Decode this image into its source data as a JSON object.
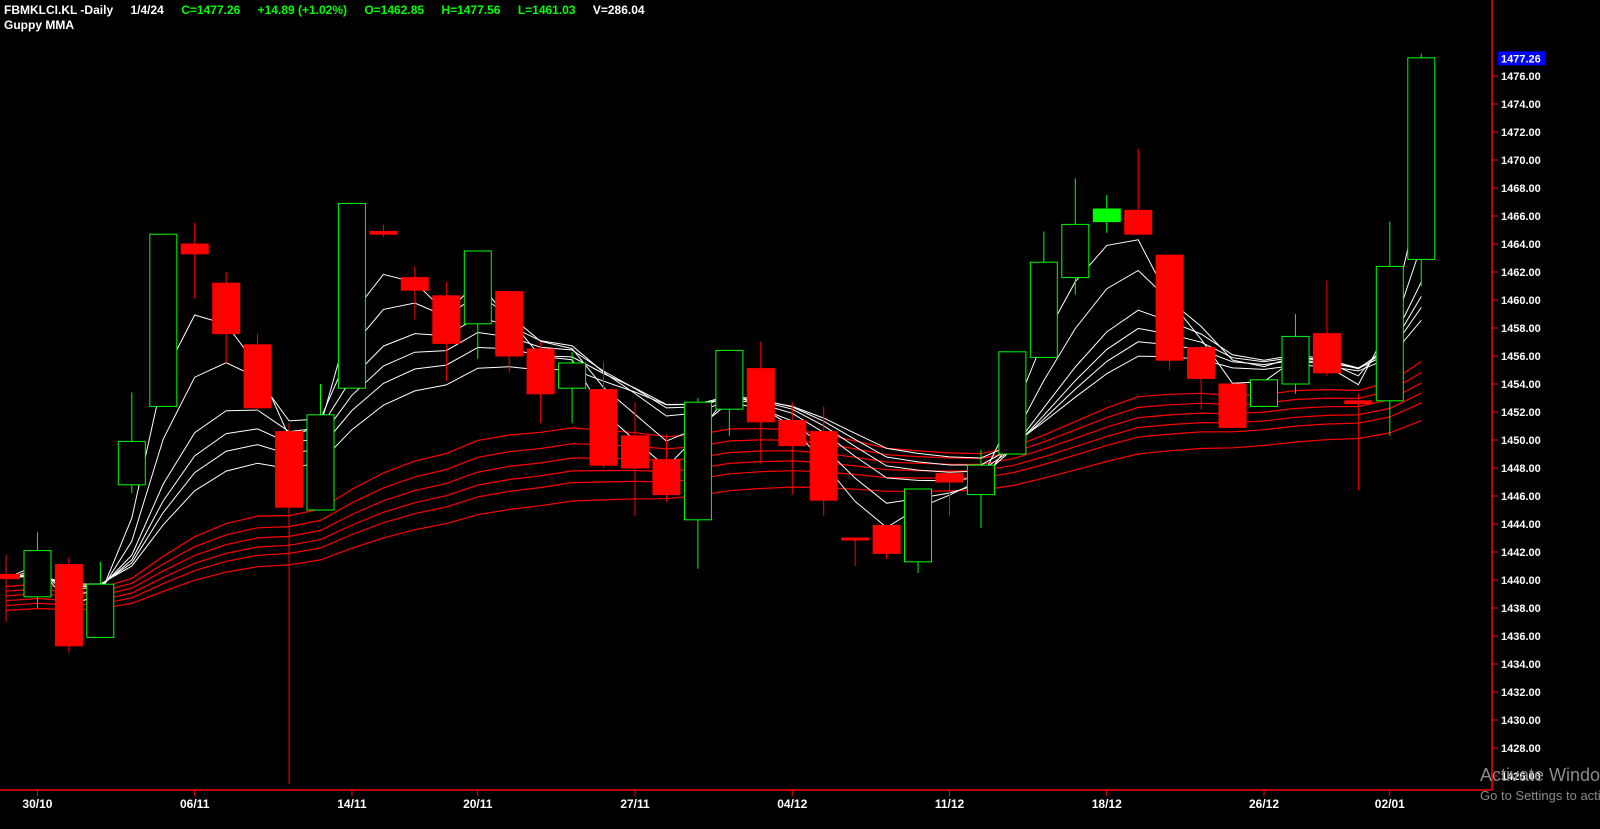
{
  "header": {
    "symbol": "FBMKLCI.KL -Daily",
    "date": "1/4/24",
    "close": "C=1477.26",
    "change": "+14.89 (+1.02%)",
    "open": "O=1462.85",
    "high": "H=1477.56",
    "low": "L=1461.03",
    "volume": "V=286.04",
    "indicator": "Guppy MMA"
  },
  "watermark": {
    "line1": "Activate Windows",
    "line2": "Go to Settings to activate Windows."
  },
  "colors": {
    "background": "#000000",
    "up": "#00ff00",
    "down": "#ff0000",
    "short_mma": "#ffffff",
    "long_mma": "#ff0000",
    "axis": "#ff0000",
    "last_price_badge": "#0000ff"
  },
  "chart_data": {
    "type": "candlestick",
    "ylim": [
      1425,
      1479
    ],
    "y_ticks": [
      1426,
      1428,
      1430,
      1432,
      1434,
      1436,
      1438,
      1440,
      1442,
      1444,
      1446,
      1448,
      1450,
      1452,
      1454,
      1456,
      1458,
      1460,
      1462,
      1464,
      1466,
      1468,
      1470,
      1472,
      1474,
      1476
    ],
    "last_price": "1477.26",
    "x_labels": [
      {
        "index": 1,
        "label": "30/10"
      },
      {
        "index": 6,
        "label": "06/11"
      },
      {
        "index": 11,
        "label": "14/11"
      },
      {
        "index": 15,
        "label": "20/11"
      },
      {
        "index": 20,
        "label": "27/11"
      },
      {
        "index": 25,
        "label": "04/12"
      },
      {
        "index": 30,
        "label": "11/12"
      },
      {
        "index": 35,
        "label": "18/12"
      },
      {
        "index": 40,
        "label": "26/12"
      },
      {
        "index": 44,
        "label": "02/01"
      }
    ],
    "candles": [
      {
        "o": 1440.4,
        "h": 1441.8,
        "l": 1437.0,
        "c": 1440.1
      },
      {
        "o": 1438.8,
        "h": 1443.4,
        "l": 1438.0,
        "c": 1442.1
      },
      {
        "o": 1441.1,
        "h": 1441.6,
        "l": 1434.8,
        "c": 1435.3
      },
      {
        "o": 1435.9,
        "h": 1441.3,
        "l": 1435.9,
        "c": 1439.7
      },
      {
        "o": 1446.8,
        "h": 1453.4,
        "l": 1446.2,
        "c": 1449.9
      },
      {
        "o": 1452.4,
        "h": 1464.7,
        "l": 1452.4,
        "c": 1464.7
      },
      {
        "o": 1464.0,
        "h": 1465.5,
        "l": 1460.1,
        "c": 1463.3
      },
      {
        "o": 1461.2,
        "h": 1462.0,
        "l": 1455.5,
        "c": 1457.6
      },
      {
        "o": 1456.8,
        "h": 1457.6,
        "l": 1452.1,
        "c": 1452.3
      },
      {
        "o": 1450.6,
        "h": 1451.2,
        "l": 1425.4,
        "c": 1445.2
      },
      {
        "o": 1445.0,
        "h": 1454.0,
        "l": 1445.0,
        "c": 1451.8
      },
      {
        "o": 1453.7,
        "h": 1466.9,
        "l": 1453.7,
        "c": 1466.9
      },
      {
        "o": 1464.9,
        "h": 1465.4,
        "l": 1464.5,
        "c": 1464.7
      },
      {
        "o": 1461.6,
        "h": 1462.4,
        "l": 1458.6,
        "c": 1460.7
      },
      {
        "o": 1460.3,
        "h": 1461.3,
        "l": 1454.2,
        "c": 1456.9
      },
      {
        "o": 1458.3,
        "h": 1463.5,
        "l": 1455.8,
        "c": 1463.5
      },
      {
        "o": 1460.6,
        "h": 1460.6,
        "l": 1454.8,
        "c": 1456.0
      },
      {
        "o": 1456.5,
        "h": 1457.0,
        "l": 1451.2,
        "c": 1453.3
      },
      {
        "o": 1453.7,
        "h": 1456.3,
        "l": 1451.2,
        "c": 1455.5
      },
      {
        "o": 1453.6,
        "h": 1455.6,
        "l": 1448.0,
        "c": 1448.2
      },
      {
        "o": 1450.3,
        "h": 1452.7,
        "l": 1444.6,
        "c": 1448.0
      },
      {
        "o": 1448.6,
        "h": 1450.4,
        "l": 1445.6,
        "c": 1446.1
      },
      {
        "o": 1444.3,
        "h": 1453.0,
        "l": 1440.8,
        "c": 1452.7
      },
      {
        "o": 1452.2,
        "h": 1456.4,
        "l": 1450.3,
        "c": 1456.4
      },
      {
        "o": 1455.1,
        "h": 1457.0,
        "l": 1448.3,
        "c": 1451.3
      },
      {
        "o": 1451.4,
        "h": 1452.7,
        "l": 1446.1,
        "c": 1449.6
      },
      {
        "o": 1450.6,
        "h": 1452.4,
        "l": 1444.6,
        "c": 1445.7
      },
      {
        "o": 1443.0,
        "h": 1443.0,
        "l": 1441.0,
        "c": 1442.9
      },
      {
        "o": 1443.9,
        "h": 1443.9,
        "l": 1441.5,
        "c": 1441.9
      },
      {
        "o": 1441.3,
        "h": 1446.5,
        "l": 1440.5,
        "c": 1446.5
      },
      {
        "o": 1447.6,
        "h": 1447.6,
        "l": 1444.6,
        "c": 1447.0
      },
      {
        "o": 1446.1,
        "h": 1449.3,
        "l": 1443.7,
        "c": 1448.2
      },
      {
        "o": 1449.0,
        "h": 1456.3,
        "l": 1449.0,
        "c": 1456.3
      },
      {
        "o": 1455.9,
        "h": 1464.9,
        "l": 1455.9,
        "c": 1462.7
      },
      {
        "o": 1461.6,
        "h": 1468.7,
        "l": 1460.4,
        "c": 1465.4
      },
      {
        "o": 1465.6,
        "h": 1467.5,
        "l": 1464.8,
        "c": 1466.5
      },
      {
        "o": 1466.4,
        "h": 1470.8,
        "l": 1464.8,
        "c": 1464.7
      },
      {
        "o": 1463.2,
        "h": 1463.2,
        "l": 1455.0,
        "c": 1455.7
      },
      {
        "o": 1456.6,
        "h": 1456.7,
        "l": 1452.2,
        "c": 1454.4
      },
      {
        "o": 1454.0,
        "h": 1454.0,
        "l": 1450.9,
        "c": 1450.9
      },
      {
        "o": 1452.4,
        "h": 1454.3,
        "l": 1452.4,
        "c": 1454.3
      },
      {
        "o": 1454.0,
        "h": 1459.0,
        "l": 1453.3,
        "c": 1457.4
      },
      {
        "o": 1457.6,
        "h": 1461.4,
        "l": 1454.6,
        "c": 1454.8
      },
      {
        "o": 1452.8,
        "h": 1453.3,
        "l": 1446.4,
        "c": 1452.6
      },
      {
        "o": 1452.8,
        "h": 1465.6,
        "l": 1450.3,
        "c": 1462.4
      },
      {
        "o": 1462.9,
        "h": 1477.6,
        "l": 1461.0,
        "c": 1477.3
      }
    ],
    "short_mma_periods": [
      3,
      5,
      8,
      10,
      12,
      15
    ],
    "long_mma_periods": [
      30,
      35,
      40,
      45,
      50,
      60
    ],
    "long_mma_seed": 1439.5
  }
}
